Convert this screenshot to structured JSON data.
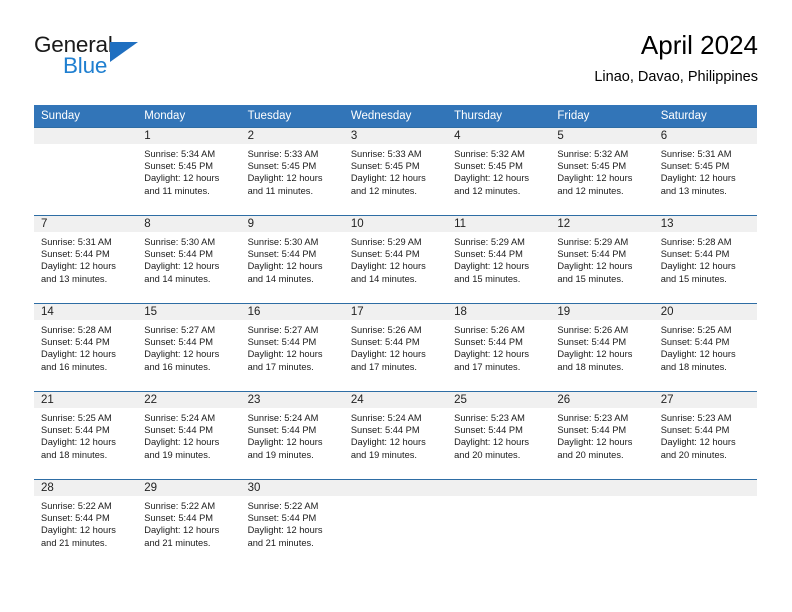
{
  "brand": {
    "name_part1": "General",
    "name_part2": "Blue",
    "accent_color": "#1f7fd0",
    "triangle_color": "#1f6fc0"
  },
  "header": {
    "title": "April 2024",
    "subtitle": "Linao, Davao, Philippines"
  },
  "theme": {
    "header_row_bg": "#3275b8",
    "header_row_text": "#ffffff",
    "day_band_bg": "#f0f0f0",
    "row_divider": "#2e6da4"
  },
  "weekday_headers": [
    "Sunday",
    "Monday",
    "Tuesday",
    "Wednesday",
    "Thursday",
    "Friday",
    "Saturday"
  ],
  "weeks": [
    [
      {
        "day": "",
        "sunrise": "",
        "sunset": "",
        "daylight_line1": "",
        "daylight_line2": ""
      },
      {
        "day": "1",
        "sunrise": "Sunrise: 5:34 AM",
        "sunset": "Sunset: 5:45 PM",
        "daylight_line1": "Daylight: 12 hours",
        "daylight_line2": "and 11 minutes."
      },
      {
        "day": "2",
        "sunrise": "Sunrise: 5:33 AM",
        "sunset": "Sunset: 5:45 PM",
        "daylight_line1": "Daylight: 12 hours",
        "daylight_line2": "and 11 minutes."
      },
      {
        "day": "3",
        "sunrise": "Sunrise: 5:33 AM",
        "sunset": "Sunset: 5:45 PM",
        "daylight_line1": "Daylight: 12 hours",
        "daylight_line2": "and 12 minutes."
      },
      {
        "day": "4",
        "sunrise": "Sunrise: 5:32 AM",
        "sunset": "Sunset: 5:45 PM",
        "daylight_line1": "Daylight: 12 hours",
        "daylight_line2": "and 12 minutes."
      },
      {
        "day": "5",
        "sunrise": "Sunrise: 5:32 AM",
        "sunset": "Sunset: 5:45 PM",
        "daylight_line1": "Daylight: 12 hours",
        "daylight_line2": "and 12 minutes."
      },
      {
        "day": "6",
        "sunrise": "Sunrise: 5:31 AM",
        "sunset": "Sunset: 5:45 PM",
        "daylight_line1": "Daylight: 12 hours",
        "daylight_line2": "and 13 minutes."
      }
    ],
    [
      {
        "day": "7",
        "sunrise": "Sunrise: 5:31 AM",
        "sunset": "Sunset: 5:44 PM",
        "daylight_line1": "Daylight: 12 hours",
        "daylight_line2": "and 13 minutes."
      },
      {
        "day": "8",
        "sunrise": "Sunrise: 5:30 AM",
        "sunset": "Sunset: 5:44 PM",
        "daylight_line1": "Daylight: 12 hours",
        "daylight_line2": "and 14 minutes."
      },
      {
        "day": "9",
        "sunrise": "Sunrise: 5:30 AM",
        "sunset": "Sunset: 5:44 PM",
        "daylight_line1": "Daylight: 12 hours",
        "daylight_line2": "and 14 minutes."
      },
      {
        "day": "10",
        "sunrise": "Sunrise: 5:29 AM",
        "sunset": "Sunset: 5:44 PM",
        "daylight_line1": "Daylight: 12 hours",
        "daylight_line2": "and 14 minutes."
      },
      {
        "day": "11",
        "sunrise": "Sunrise: 5:29 AM",
        "sunset": "Sunset: 5:44 PM",
        "daylight_line1": "Daylight: 12 hours",
        "daylight_line2": "and 15 minutes."
      },
      {
        "day": "12",
        "sunrise": "Sunrise: 5:29 AM",
        "sunset": "Sunset: 5:44 PM",
        "daylight_line1": "Daylight: 12 hours",
        "daylight_line2": "and 15 minutes."
      },
      {
        "day": "13",
        "sunrise": "Sunrise: 5:28 AM",
        "sunset": "Sunset: 5:44 PM",
        "daylight_line1": "Daylight: 12 hours",
        "daylight_line2": "and 15 minutes."
      }
    ],
    [
      {
        "day": "14",
        "sunrise": "Sunrise: 5:28 AM",
        "sunset": "Sunset: 5:44 PM",
        "daylight_line1": "Daylight: 12 hours",
        "daylight_line2": "and 16 minutes."
      },
      {
        "day": "15",
        "sunrise": "Sunrise: 5:27 AM",
        "sunset": "Sunset: 5:44 PM",
        "daylight_line1": "Daylight: 12 hours",
        "daylight_line2": "and 16 minutes."
      },
      {
        "day": "16",
        "sunrise": "Sunrise: 5:27 AM",
        "sunset": "Sunset: 5:44 PM",
        "daylight_line1": "Daylight: 12 hours",
        "daylight_line2": "and 17 minutes."
      },
      {
        "day": "17",
        "sunrise": "Sunrise: 5:26 AM",
        "sunset": "Sunset: 5:44 PM",
        "daylight_line1": "Daylight: 12 hours",
        "daylight_line2": "and 17 minutes."
      },
      {
        "day": "18",
        "sunrise": "Sunrise: 5:26 AM",
        "sunset": "Sunset: 5:44 PM",
        "daylight_line1": "Daylight: 12 hours",
        "daylight_line2": "and 17 minutes."
      },
      {
        "day": "19",
        "sunrise": "Sunrise: 5:26 AM",
        "sunset": "Sunset: 5:44 PM",
        "daylight_line1": "Daylight: 12 hours",
        "daylight_line2": "and 18 minutes."
      },
      {
        "day": "20",
        "sunrise": "Sunrise: 5:25 AM",
        "sunset": "Sunset: 5:44 PM",
        "daylight_line1": "Daylight: 12 hours",
        "daylight_line2": "and 18 minutes."
      }
    ],
    [
      {
        "day": "21",
        "sunrise": "Sunrise: 5:25 AM",
        "sunset": "Sunset: 5:44 PM",
        "daylight_line1": "Daylight: 12 hours",
        "daylight_line2": "and 18 minutes."
      },
      {
        "day": "22",
        "sunrise": "Sunrise: 5:24 AM",
        "sunset": "Sunset: 5:44 PM",
        "daylight_line1": "Daylight: 12 hours",
        "daylight_line2": "and 19 minutes."
      },
      {
        "day": "23",
        "sunrise": "Sunrise: 5:24 AM",
        "sunset": "Sunset: 5:44 PM",
        "daylight_line1": "Daylight: 12 hours",
        "daylight_line2": "and 19 minutes."
      },
      {
        "day": "24",
        "sunrise": "Sunrise: 5:24 AM",
        "sunset": "Sunset: 5:44 PM",
        "daylight_line1": "Daylight: 12 hours",
        "daylight_line2": "and 19 minutes."
      },
      {
        "day": "25",
        "sunrise": "Sunrise: 5:23 AM",
        "sunset": "Sunset: 5:44 PM",
        "daylight_line1": "Daylight: 12 hours",
        "daylight_line2": "and 20 minutes."
      },
      {
        "day": "26",
        "sunrise": "Sunrise: 5:23 AM",
        "sunset": "Sunset: 5:44 PM",
        "daylight_line1": "Daylight: 12 hours",
        "daylight_line2": "and 20 minutes."
      },
      {
        "day": "27",
        "sunrise": "Sunrise: 5:23 AM",
        "sunset": "Sunset: 5:44 PM",
        "daylight_line1": "Daylight: 12 hours",
        "daylight_line2": "and 20 minutes."
      }
    ],
    [
      {
        "day": "28",
        "sunrise": "Sunrise: 5:22 AM",
        "sunset": "Sunset: 5:44 PM",
        "daylight_line1": "Daylight: 12 hours",
        "daylight_line2": "and 21 minutes."
      },
      {
        "day": "29",
        "sunrise": "Sunrise: 5:22 AM",
        "sunset": "Sunset: 5:44 PM",
        "daylight_line1": "Daylight: 12 hours",
        "daylight_line2": "and 21 minutes."
      },
      {
        "day": "30",
        "sunrise": "Sunrise: 5:22 AM",
        "sunset": "Sunset: 5:44 PM",
        "daylight_line1": "Daylight: 12 hours",
        "daylight_line2": "and 21 minutes."
      },
      {
        "day": "",
        "sunrise": "",
        "sunset": "",
        "daylight_line1": "",
        "daylight_line2": ""
      },
      {
        "day": "",
        "sunrise": "",
        "sunset": "",
        "daylight_line1": "",
        "daylight_line2": ""
      },
      {
        "day": "",
        "sunrise": "",
        "sunset": "",
        "daylight_line1": "",
        "daylight_line2": ""
      },
      {
        "day": "",
        "sunrise": "",
        "sunset": "",
        "daylight_line1": "",
        "daylight_line2": ""
      }
    ]
  ]
}
